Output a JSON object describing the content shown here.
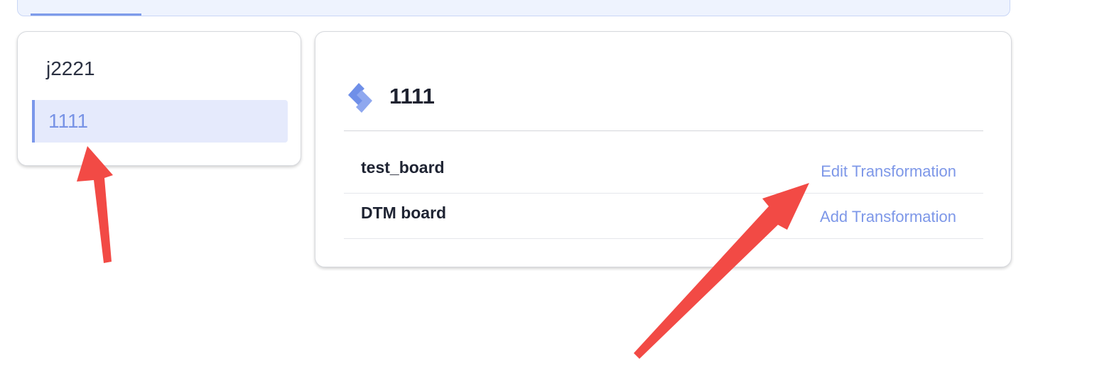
{
  "projects": {
    "items": [
      {
        "label": "j2221",
        "active": false
      },
      {
        "label": "1111",
        "active": true
      }
    ]
  },
  "detail": {
    "icon": "jira-icon",
    "title": "1111",
    "boards": [
      {
        "name": "test_board",
        "action": "Edit Transformation"
      },
      {
        "name": "DTM board",
        "action": "Add Transformation"
      }
    ]
  },
  "colors": {
    "accent": "#7b97ea",
    "active_bg": "#e5eafc",
    "annotation": "#f24a45"
  }
}
